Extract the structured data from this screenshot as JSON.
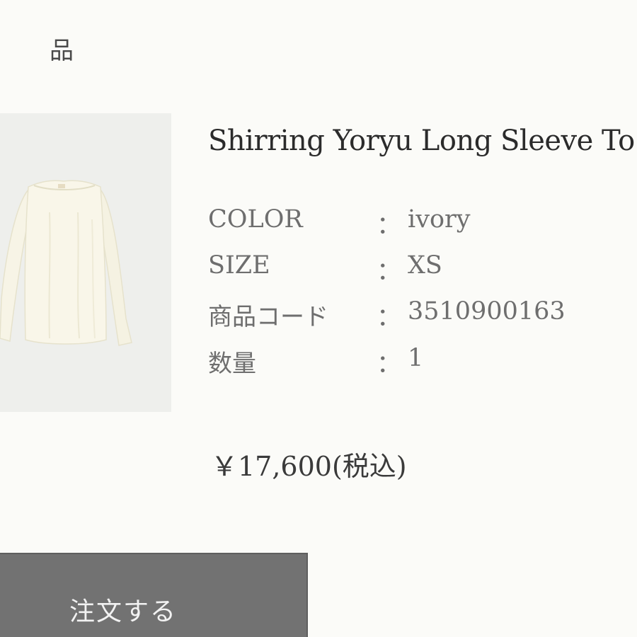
{
  "header": {
    "label": "品"
  },
  "product": {
    "image_alt": "ivory long sleeve top",
    "title": "Shirring Yoryu Long Sleeve To",
    "attributes": [
      {
        "label": "COLOR",
        "colon": "：",
        "value": "ivory"
      },
      {
        "label": "SIZE",
        "colon": "：",
        "value": "XS"
      },
      {
        "label": "商品コード",
        "colon": "：",
        "value": "3510900163"
      },
      {
        "label": "数量",
        "colon": "：",
        "value": "1"
      }
    ],
    "price": "￥17,600(税込)"
  },
  "order_button": {
    "label": "注文する"
  },
  "colors": {
    "background": "#fbfbf8",
    "image_background": "#eeefec",
    "garment": "#f7f4e6",
    "button": "#727272",
    "button_text": "#f2f2f2"
  }
}
